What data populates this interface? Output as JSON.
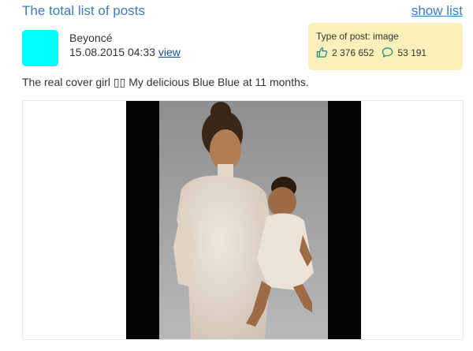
{
  "header": {
    "title": "The total list of posts",
    "show_list_label": "show list"
  },
  "post": {
    "author": "Beyoncé",
    "datetime": "15.08.2015 04:33",
    "view_label": "view",
    "type_label": "Type of post: image",
    "likes": "2 376 652",
    "comments": "53 191",
    "caption": "The real cover girl ▯▯ My delicious Blue Blue at 11 months.",
    "avatar_color": "#00ffff",
    "accent_color": "#1a8c7a",
    "stats_bg": "#fbf0b9",
    "like_icon": "thumbs-up-icon",
    "comment_icon": "speech-bubble-icon"
  }
}
